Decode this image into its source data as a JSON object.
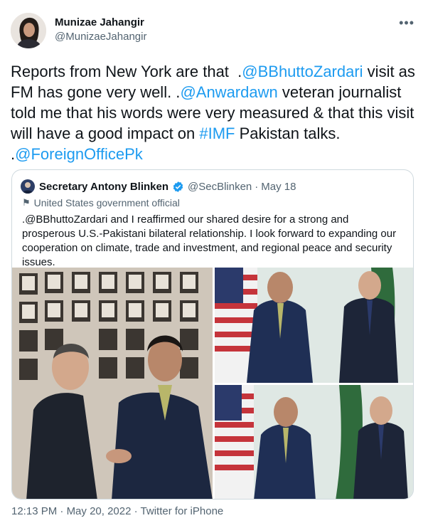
{
  "author": {
    "display_name": "Munizae Jahangir",
    "handle": "@MunizaeJahangir"
  },
  "more_icon": "more-horizontal-icon",
  "tweet": {
    "segments": [
      {
        "text": "Reports from New York are that  .",
        "link": false
      },
      {
        "text": "@BBhuttoZardari",
        "link": true
      },
      {
        "text": " visit as FM has gone very well. .",
        "link": false
      },
      {
        "text": "@Anwardawn",
        "link": true
      },
      {
        "text": " veteran journalist told me that his words were very measured & that this visit will have a good impact on ",
        "link": false
      },
      {
        "text": "#IMF",
        "link": true
      },
      {
        "text": " Pakistan talks. .",
        "link": false
      },
      {
        "text": "@ForeignOfficePk",
        "link": true
      }
    ]
  },
  "quote": {
    "display_name": "Secretary Antony Blinken",
    "handle": "@SecBlinken",
    "separator": "·",
    "date": "May 18",
    "label": "United States government official",
    "text": ".@BBhuttoZardari and I reaffirmed our shared desire for a strong and prosperous U.S.-Pakistani bilateral relationship. I look forward to expanding our cooperation on climate, trade and investment, and regional peace and security issues."
  },
  "footer": {
    "time": "12:13 PM",
    "sep1": " · ",
    "date": "May 20, 2022",
    "sep2": " · ",
    "source": "Twitter for iPhone"
  },
  "colors": {
    "link": "#1d9bf0",
    "muted": "#536471",
    "border": "#cfd9de",
    "verified": "#1d9bf0"
  }
}
